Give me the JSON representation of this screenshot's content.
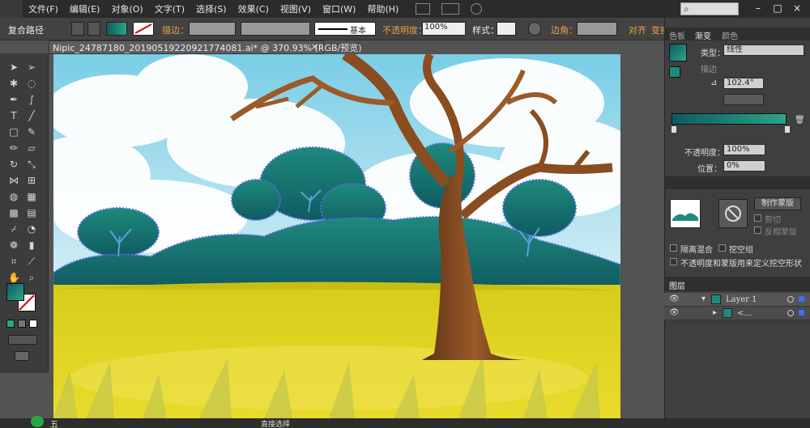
{
  "menubar": {
    "items": [
      "文件(F)",
      "编辑(E)",
      "对象(O)",
      "文字(T)",
      "选择(S)",
      "效果(C)",
      "视图(V)",
      "窗口(W)",
      "帮助(H)"
    ]
  },
  "controlbar": {
    "selection_type": "复合路径",
    "stroke_label": "描边：",
    "stroke_style": "基本",
    "opacity_label": "不透明度：",
    "opacity_value": "100%",
    "style_label": "样式：",
    "corner_label": "边角：",
    "align_label": "对齐",
    "transform_label": "变换"
  },
  "document": {
    "tab_title": "Nipic_24787180_20190519220921774081.ai* @ 370.93% (RGB/预览)",
    "close_glyph": "×"
  },
  "gradient_panel": {
    "tabs": [
      "色板",
      "渐变",
      "颜色"
    ],
    "type_label": "类型：",
    "type_value": "线性",
    "stroke_label": "描边",
    "angle_value": "102.4°",
    "opacity_label": "不透明度：",
    "opacity_value": "100%",
    "position_label": "位置：",
    "position_value": "0%"
  },
  "transparency_panel": {
    "mask_button": "制作蒙版",
    "clip_label": "剪切",
    "invert_label": "反相蒙版",
    "isolate_label": "隔离混合",
    "knockout_label": "挖空组",
    "opacity_mask_label": "不透明度和蒙版用来定义挖空形状"
  },
  "layers_panel": {
    "title": "图层",
    "layer1": "Layer 1",
    "sublayer": "<..."
  },
  "statusbar": {
    "tool_name": "直接选择",
    "ime": "五"
  },
  "colors": {
    "teal_dark": "#0f5b61",
    "teal_light": "#2aa587",
    "accent_orange": "#e8a045"
  }
}
